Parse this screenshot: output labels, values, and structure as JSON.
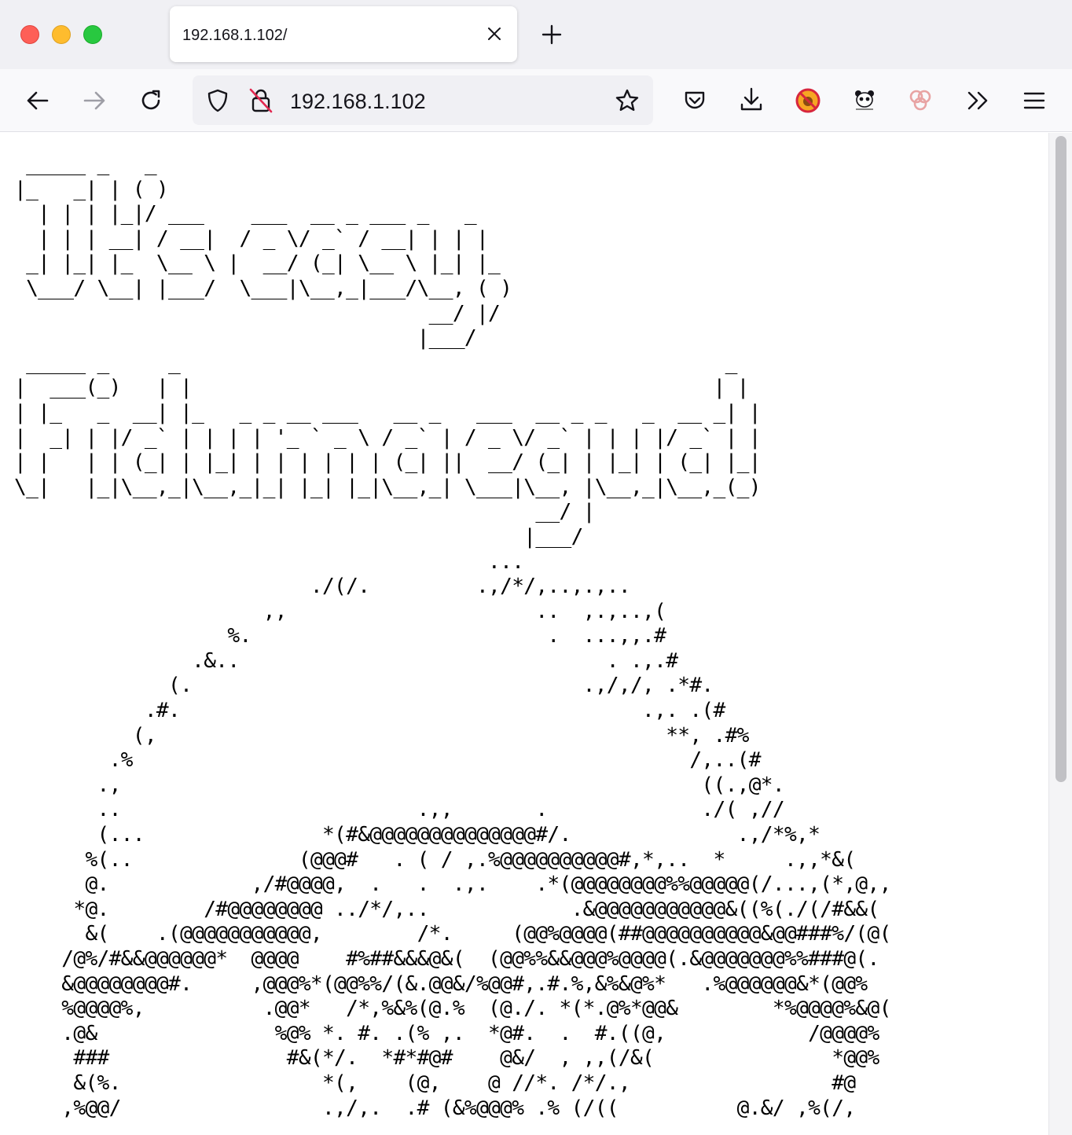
{
  "browser": {
    "tab": {
      "title": "192.168.1.102/"
    },
    "url": "192.168.1.102",
    "icons": {
      "traffic": [
        "close-window",
        "minimize-window",
        "zoom-window"
      ],
      "nav": [
        "back-arrow-icon",
        "forward-arrow-icon",
        "reload-icon"
      ],
      "urlbar": [
        "tracking-shield-icon",
        "insecure-lock-icon",
        "bookmark-star-icon"
      ],
      "extensions": [
        "pocket-icon",
        "download-icon",
        "blocked-extension-icon",
        "panda-extension-icon",
        "flower-extension-icon",
        "overflow-chevrons-icon",
        "menu-icon"
      ]
    }
  },
  "page": {
    "ascii_lines": [
      " _____ _   _",
      "|_   _| | ( )",
      "  | | | |_|/ ___    ___  __ _ ___ _   _",
      "  | | | __| / __|  / _ \\/ _` / __| | | |",
      " _| |_| |_  \\__ \\ |  __/ (_| \\__ \\ |_| |_",
      " \\___/ \\__| |___/  \\___|\\__,_|___/\\__, ( )",
      "                                   __/ |/",
      "                                  |___/",
      " _____ _     _                                              _",
      "|  ___(_)   | |                                            | |",
      "| |_   _  __| |_   _ _ __ ___   __ _   ___  __ _ _   _  __ _| |",
      "|  _| | |/ _` | | | | '_ ` _ \\ / _` | / _ \\/ _` | | | |/ _` | |",
      "| |   | | (_| | |_| | | | | | | (_| ||  __/ (_| | |_| | (_| |_|",
      "\\_|   |_|\\__,_|\\__,_|_| |_| |_|\\__,_| \\___|\\__, |\\__,_|\\__,_(_)",
      "                                            __/ |",
      "                                           |___/",
      "                                        ...",
      "                         ./(/.         .,/*/,..,.,..",
      "                     ,,                     ..  ,.,..,(",
      "                  %.                         .  ...,,.#",
      "               .&..                               . .,.#",
      "             (.                                 .,/,/, .*#.",
      "           .#.                                       .,. .(#",
      "          (,                                           **, .#%",
      "        .%                                               /,..(#",
      "       .,                                                 ((.,@*.",
      "       ..                         .,,       .             ./( ,//",
      "       (...               *(#&@@@@@@@@@@@@@@#/.              .,/*%,*",
      "      %(..              (@@@#   . ( / ,.%@@@@@@@@@@#,*,..  *     .,,*&(",
      "      @.            ,/#@@@@,  .   .  .,.    .*(@@@@@@@@%%@@@@@(/...,(*,@,,",
      "     *@.        /#@@@@@@@@ ../*/,..            .&@@@@@@@@@@@&((%(./(/#&&(",
      "      &(    .(@@@@@@@@@@@,        /*.     (@@%@@@@(##@@@@@@@@@@&@@###%/(@(",
      "    /@%/#&&@@@@@@*  @@@@    #%##&&&@&(  (@@%%&&@@@%@@@@(.&@@@@@@@%%###@(.",
      "    &@@@@@@@@#.     ,@@@%*(@@%%/(&.@@&/%@@#,.#.%,&%&@%*   .%@@@@@@&*(@@%",
      "    %@@@@%,          .@@*   /*,%&%(@.%  (@./. *(*.@%*@@&        *%@@@@%&@(",
      "    .@&               %@% *. #. .(% ,.  *@#.  .  #.((@,            /@@@@%",
      "     ###               #&(*/.  *#*#@#    @&/  , ,,(/&(               *@@%",
      "     &(%.                 *(,    (@,    @ //*. /*/.,                 #@",
      "    ,%@@/                 .,/,.  .# (&%@@@% .% (/((          @.&/ ,%(/,"
    ]
  }
}
